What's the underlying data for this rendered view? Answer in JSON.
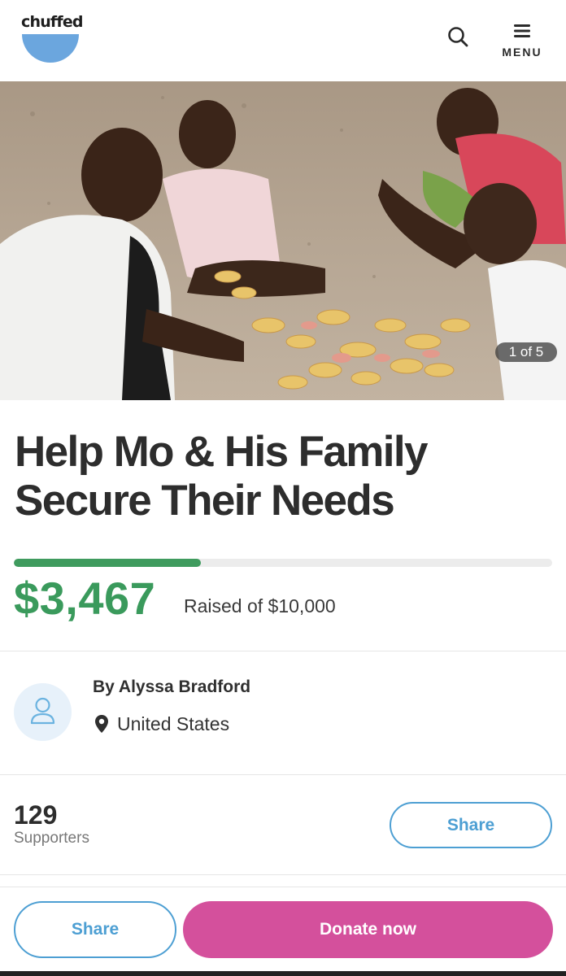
{
  "brand": {
    "logo_text": "chuffed",
    "logo_color": "#6ba6de"
  },
  "header": {
    "menu_label": "MENU",
    "search_icon": "search-icon",
    "menu_icon": "hamburger-icon"
  },
  "hero": {
    "image_counter": "1 of 5"
  },
  "campaign": {
    "title": "Help Mo & His Family Secure Their Needs",
    "raised_amount": "$3,467",
    "raised_of_text": "Raised of $10,000",
    "progress_fraction": 0.3467
  },
  "organiser": {
    "name": "By Alyssa Bradford",
    "location": "United States"
  },
  "supporters": {
    "count": "129",
    "label": "Supporters",
    "share_label": "Share"
  },
  "footer": {
    "share_label": "Share",
    "donate_label": "Donate now"
  },
  "colors": {
    "accent_green": "#3a9a5c",
    "accent_blue": "#4d9fd3",
    "donate_pink": "#d4509c"
  }
}
